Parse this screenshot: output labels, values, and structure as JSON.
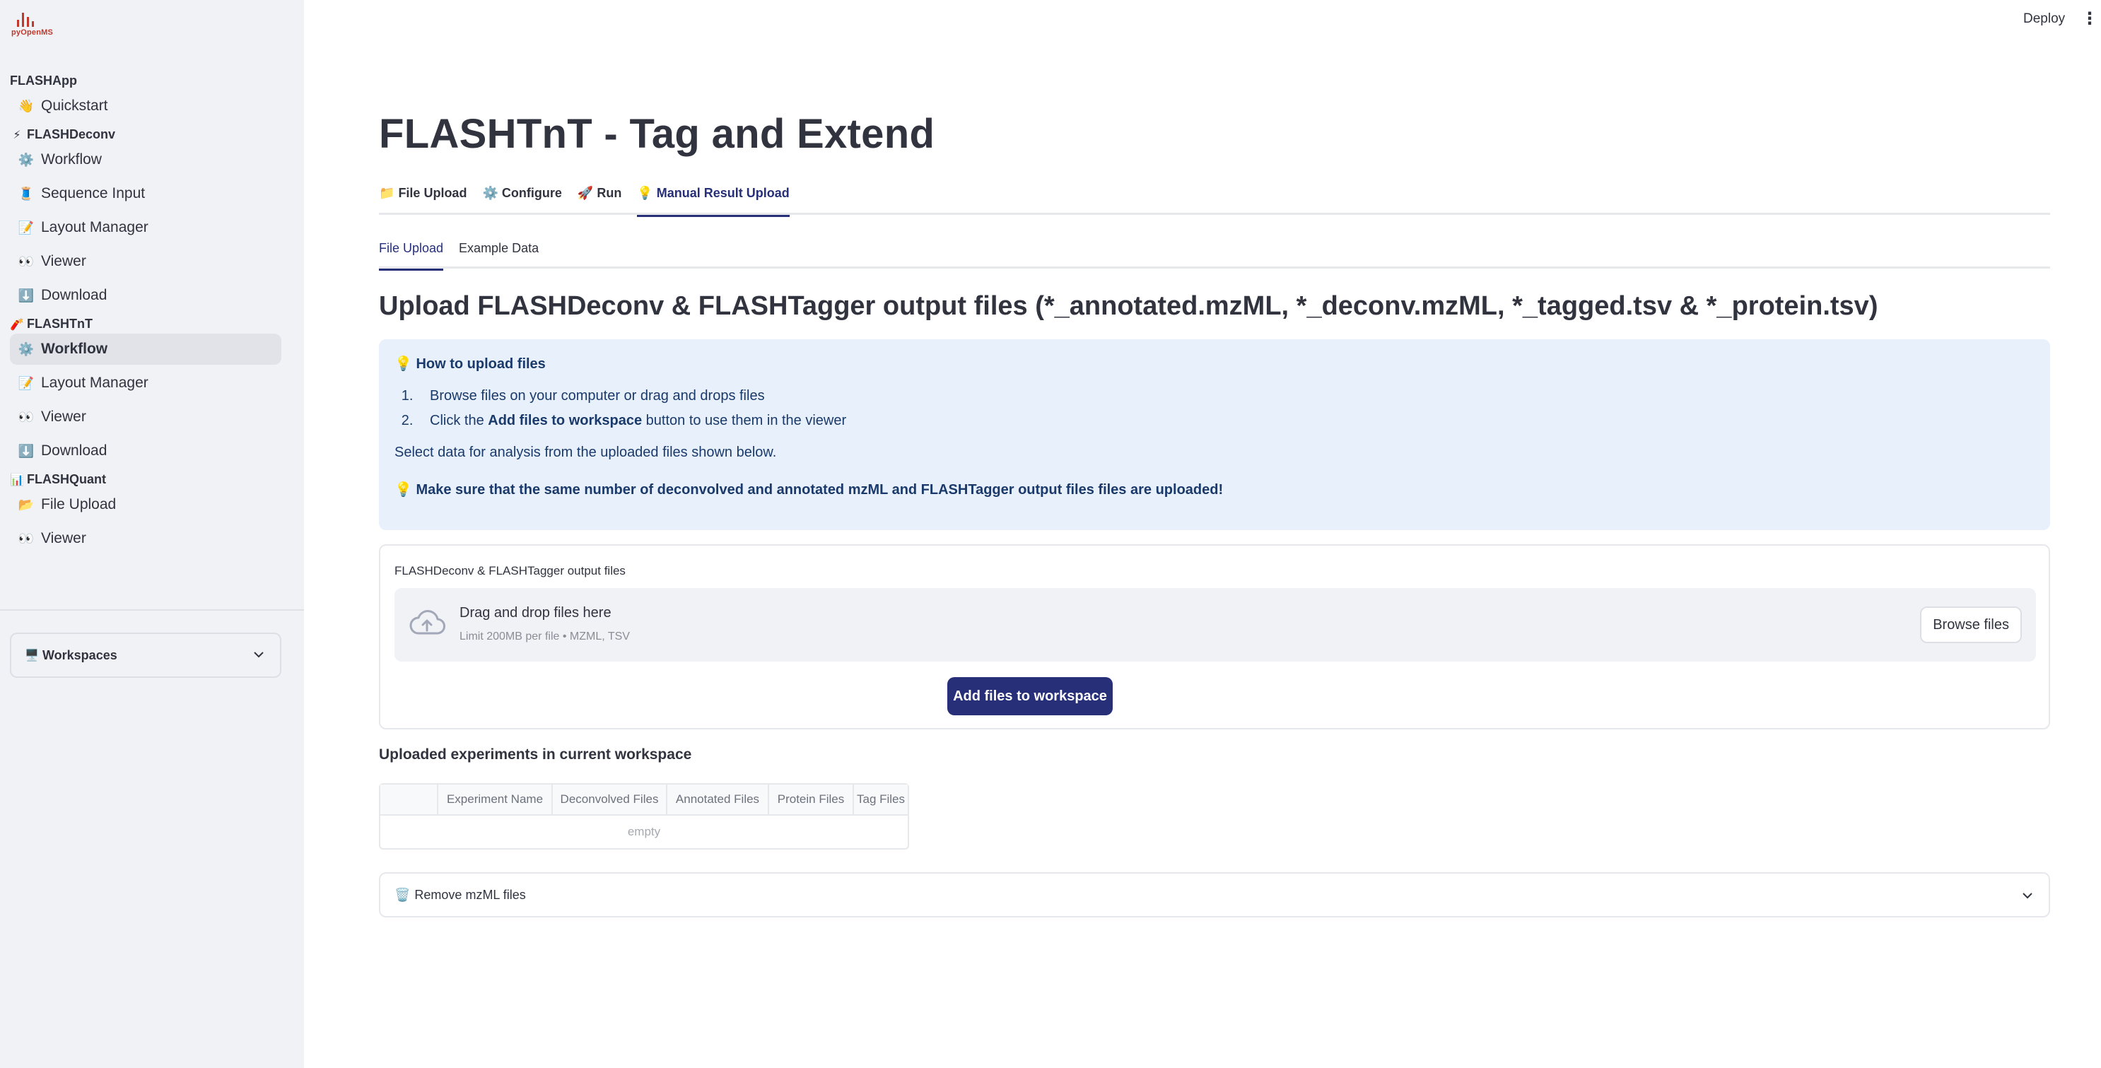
{
  "logo": {
    "text": "pyOpenMS"
  },
  "sidebar": {
    "groups": [
      {
        "label": "FLASHApp",
        "icon": "",
        "items": [
          {
            "icon": "👋",
            "label": "Quickstart"
          }
        ]
      },
      {
        "label": "FLASHDeconv",
        "icon": "⚡",
        "items": [
          {
            "icon": "⚙️",
            "label": "Workflow"
          },
          {
            "icon": "🧵",
            "label": "Sequence Input"
          },
          {
            "icon": "📝",
            "label": "Layout Manager"
          },
          {
            "icon": "👀",
            "label": "Viewer"
          },
          {
            "icon": "⬇️",
            "label": "Download"
          }
        ]
      },
      {
        "label": "FLASHTnT",
        "icon": "🧨",
        "items": [
          {
            "icon": "⚙️",
            "label": "Workflow",
            "active": true
          },
          {
            "icon": "📝",
            "label": "Layout Manager"
          },
          {
            "icon": "👀",
            "label": "Viewer"
          },
          {
            "icon": "⬇️",
            "label": "Download"
          }
        ]
      },
      {
        "label": "FLASHQuant",
        "icon": "📊",
        "items": [
          {
            "icon": "📂",
            "label": "File Upload"
          },
          {
            "icon": "👀",
            "label": "Viewer"
          }
        ]
      }
    ],
    "workspaces": {
      "icon": "🖥️",
      "label": "Workspaces"
    }
  },
  "topbar": {
    "deploy": "Deploy",
    "menu": "⋮"
  },
  "main": {
    "title": "FLASHTnT - Tag and Extend",
    "tabs": [
      {
        "icon": "📁",
        "label": "File Upload"
      },
      {
        "icon": "⚙️",
        "label": "Configure"
      },
      {
        "icon": "🚀",
        "label": "Run"
      },
      {
        "icon": "💡",
        "label": "Manual Result Upload",
        "active": true
      }
    ],
    "subtabs": [
      {
        "label": "File Upload",
        "active": true
      },
      {
        "label": "Example Data"
      }
    ],
    "section_title": "Upload FLASHDeconv & FLASHTagger output files (*_annotated.mzML, *_deconv.mzML, *_tagged.tsv & *_protein.tsv)",
    "info": {
      "heading_icon": "💡",
      "heading": "How to upload files",
      "step1": "Browse files on your computer or drag and drops files",
      "step2_pre": "Click the ",
      "step2_bold": "Add files to workspace",
      "step2_post": " button to use them in the viewer",
      "paragraph": "Select data for analysis from the uploaded files shown below.",
      "warning_icon": "💡",
      "warning": "Make sure that the same number of deconvolved and annotated mzML and FLASHTagger output files files are uploaded!"
    },
    "uploader": {
      "label": "FLASHDeconv & FLASHTagger output files",
      "drag_text": "Drag and drop files here",
      "limit_text": "Limit 200MB per file • MZML, TSV",
      "browse_label": "Browse files",
      "add_button": "Add files to workspace"
    },
    "uploaded": {
      "title": "Uploaded experiments in current workspace",
      "columns": [
        "",
        "Experiment Name",
        "Deconvolved Files",
        "Annotated Files",
        "Protein Files",
        "Tag Files"
      ],
      "empty_text": "empty"
    },
    "expander": {
      "icon": "🗑️",
      "label": "Remove mzML files"
    }
  },
  "colors": {
    "accent": "#262f78",
    "sidebar_bg": "#f0f2f6",
    "info_bg": "#e8f0fb"
  }
}
